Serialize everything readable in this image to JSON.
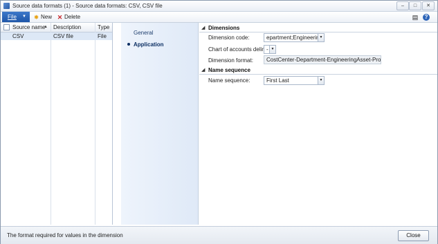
{
  "window": {
    "title": "Source data formats (1) - Source data formats: CSV, CSV file",
    "controls": [
      "–",
      "□",
      "✕"
    ]
  },
  "toolbar": {
    "file_label": "File",
    "new_label": "New",
    "delete_label": "Delete"
  },
  "grid": {
    "columns": [
      "Source name",
      "Description",
      "Type"
    ],
    "rows": [
      {
        "source_name": "CSV",
        "description": "CSV file",
        "type": "File"
      }
    ]
  },
  "nav": {
    "items": [
      "General",
      "Application"
    ],
    "active": "Application"
  },
  "dimensions": {
    "title": "Dimensions",
    "dimension_code_label": "Dimension code:",
    "dimension_code_value": "epartment;EngineeringAsse",
    "delimiter_label": "Chart of accounts delimiter:",
    "delimiter_value": "-",
    "dimension_format_label": "Dimension format:",
    "dimension_format_value": "CostCenter-Department-EngineeringAsset-Project"
  },
  "name_sequence": {
    "title": "Name sequence",
    "label": "Name sequence:",
    "value": "First Last"
  },
  "status": {
    "text": "The format required for values in the dimension",
    "close_label": "Close"
  },
  "colors": {
    "accent": "#1f56a8",
    "selected_row": "#dde8f6",
    "nav_background": "#dfe9f7"
  }
}
